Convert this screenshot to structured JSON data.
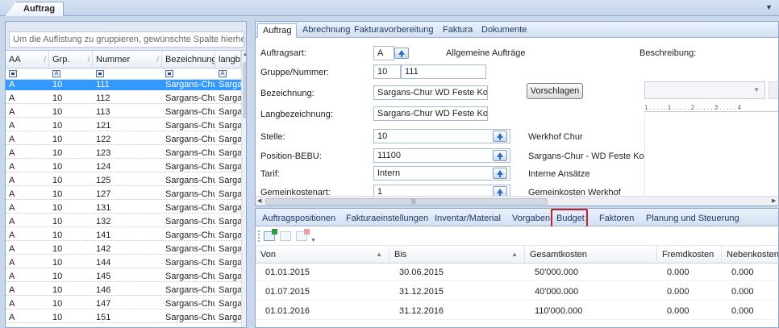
{
  "doc_tab": {
    "label": "Auftrag"
  },
  "list": {
    "group_hint": "Um die Auflistung zu gruppieren, gewünschte Spalte hierhe",
    "columns": [
      "AA",
      "Grp.",
      "Nummer",
      "Bezeichnung",
      "langb"
    ],
    "filter_icons": [
      "solid",
      "A",
      "solid",
      "solid",
      "A"
    ],
    "rows": [
      [
        "A",
        "10",
        "111",
        "Sargans-Chu...",
        "Sarga"
      ],
      [
        "A",
        "10",
        "112",
        "Sargans-Chu...",
        "Sarga"
      ],
      [
        "A",
        "10",
        "113",
        "Sargans-Chu...",
        "Sarga"
      ],
      [
        "A",
        "10",
        "121",
        "Sargans-Chu...",
        "Sarga"
      ],
      [
        "A",
        "10",
        "122",
        "Sargans-Chu...",
        "Sarga"
      ],
      [
        "A",
        "10",
        "123",
        "Sargans-Chu...",
        "Sarga"
      ],
      [
        "A",
        "10",
        "124",
        "Sargans-Chu...",
        "Sarga"
      ],
      [
        "A",
        "10",
        "125",
        "Sargans-Chu...",
        "Sarga"
      ],
      [
        "A",
        "10",
        "127",
        "Sargans-Chu...",
        "Sarga"
      ],
      [
        "A",
        "10",
        "131",
        "Sargans-Chu...",
        "Sarga"
      ],
      [
        "A",
        "10",
        "132",
        "Sargans-Chu...",
        "Sarga"
      ],
      [
        "A",
        "10",
        "141",
        "Sargans-Chu...",
        "Sarga"
      ],
      [
        "A",
        "10",
        "142",
        "Sargans-Chu...",
        "Sarga"
      ],
      [
        "A",
        "10",
        "144",
        "Sargans-Chu...",
        "Sarga"
      ],
      [
        "A",
        "10",
        "145",
        "Sargans-Chu...",
        "Sarga"
      ],
      [
        "A",
        "10",
        "146",
        "Sargans-Chu...",
        "Sarga"
      ],
      [
        "A",
        "10",
        "147",
        "Sargans-Chu...",
        "Sarga"
      ],
      [
        "A",
        "10",
        "151",
        "Sargans-Chu...",
        "Sarga"
      ]
    ],
    "selected_row": 0
  },
  "top_tabs": [
    "Auftrag",
    "Abrechnung",
    "Fakturavorbereitung",
    "Faktura",
    "Dokumente"
  ],
  "form": {
    "auftragsart_label": "Auftragsart:",
    "auftragsart_value": "A",
    "auftragsart_desc": "Allgemeine Aufträge",
    "gruppe_label": "Gruppe/Nummer:",
    "gruppe_value": "10",
    "nummer_value": "111",
    "vorschlagen": "Vorschlagen",
    "bezeichnung_label": "Bezeichnung:",
    "bezeichnung_value": "Sargans-Chur WD Feste Kosten",
    "langbezeichnung_label": "Langbezeichnung:",
    "langbezeichnung_value": "Sargans-Chur WD Feste Kosten",
    "stelle_label": "Stelle:",
    "stelle_value": "10",
    "stelle_desc": "Werkhof Chur",
    "position_label": "Position-BEBU:",
    "position_value": "11100",
    "position_desc": "Sargans-Chur - WD Feste Kosten",
    "tarif_label": "Tarif:",
    "tarif_value": "Intern",
    "tarif_desc": "Interne Ansätze",
    "gemeinkosten_label": "Gemeinkostenart:",
    "gemeinkosten_value": "1",
    "gemeinkosten_desc": "Gemeinkosten Werkhof",
    "beschreibung_label": "Beschreibung:",
    "ruler": "1 . . . . . 1 . . . . . 2 . . . . . 3 . . . . . 4"
  },
  "bottom_tabs": [
    "Auftragspositionen",
    "Fakturaeinstellungen",
    "Inventar/Material",
    "Vorgaben",
    "Budget",
    "Faktoren",
    "Planung und Steuerung"
  ],
  "budget": {
    "columns": [
      "Von",
      "Bis",
      "Gesamtkosten",
      "Fremdkosten",
      "Nebenkosten"
    ],
    "rows": [
      [
        "01.01.2015",
        "30.06.2015",
        "50'000.000",
        "0.000",
        "0.000"
      ],
      [
        "01.07.2015",
        "31.12.2015",
        "40'000.000",
        "0.000",
        "0.000"
      ],
      [
        "01.01.2016",
        "31.12.2016",
        "110'000.000",
        "0.000",
        "0.000"
      ]
    ]
  },
  "colors": {
    "selection": "#3399ff",
    "highlight": "#c81e2a",
    "border": "#8ea8cc"
  }
}
